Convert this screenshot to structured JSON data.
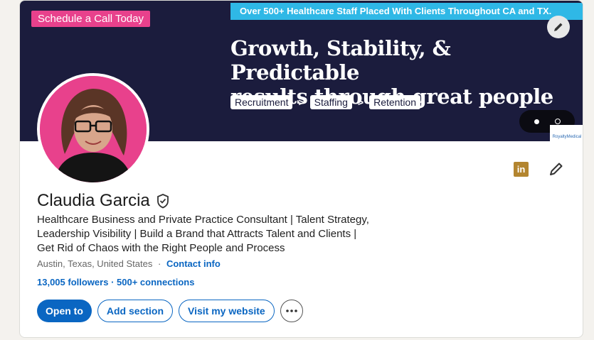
{
  "banner": {
    "tag": "Schedule a Call Today",
    "ribbon": "Over 500+ Healthcare Staff Placed With Clients Throughout CA and TX.",
    "headline_line1": "Growth, Stability, & Predictable",
    "headline_line2": "results through great people",
    "pills": [
      "Recruitment",
      "Staffing",
      "Retention"
    ],
    "arrow": ">",
    "brand_mark": "RoyaltyMedical",
    "colors": {
      "background": "#1b1c3d",
      "tag": "#e8418c",
      "ribbon": "#2fb8e6"
    }
  },
  "profile": {
    "name": "Claudia Garcia",
    "headline": "Healthcare Business and Private Practice Consultant | Talent Strategy,\nLeadership Visibility  | Build a Brand that Attracts Talent and Clients |\nGet Rid of Chaos with the Right People and Process",
    "location": "Austin, Texas, United States",
    "location_sep": "·",
    "contact_info": "Contact info",
    "followers": "13,005 followers",
    "network_sep": " · ",
    "connections": "500+ connections"
  },
  "actions": {
    "open_to": "Open to",
    "add_section": "Add section",
    "visit_website": "Visit my website",
    "more": "more-horizontal-icon"
  },
  "icons": {
    "edit_cover": "pencil-icon",
    "linkedin": "in",
    "edit_intro": "pencil-icon",
    "verified": "shield-check-icon"
  },
  "theme": {
    "accent": "#0a66c2",
    "page_bg": "#f4f2ee"
  }
}
